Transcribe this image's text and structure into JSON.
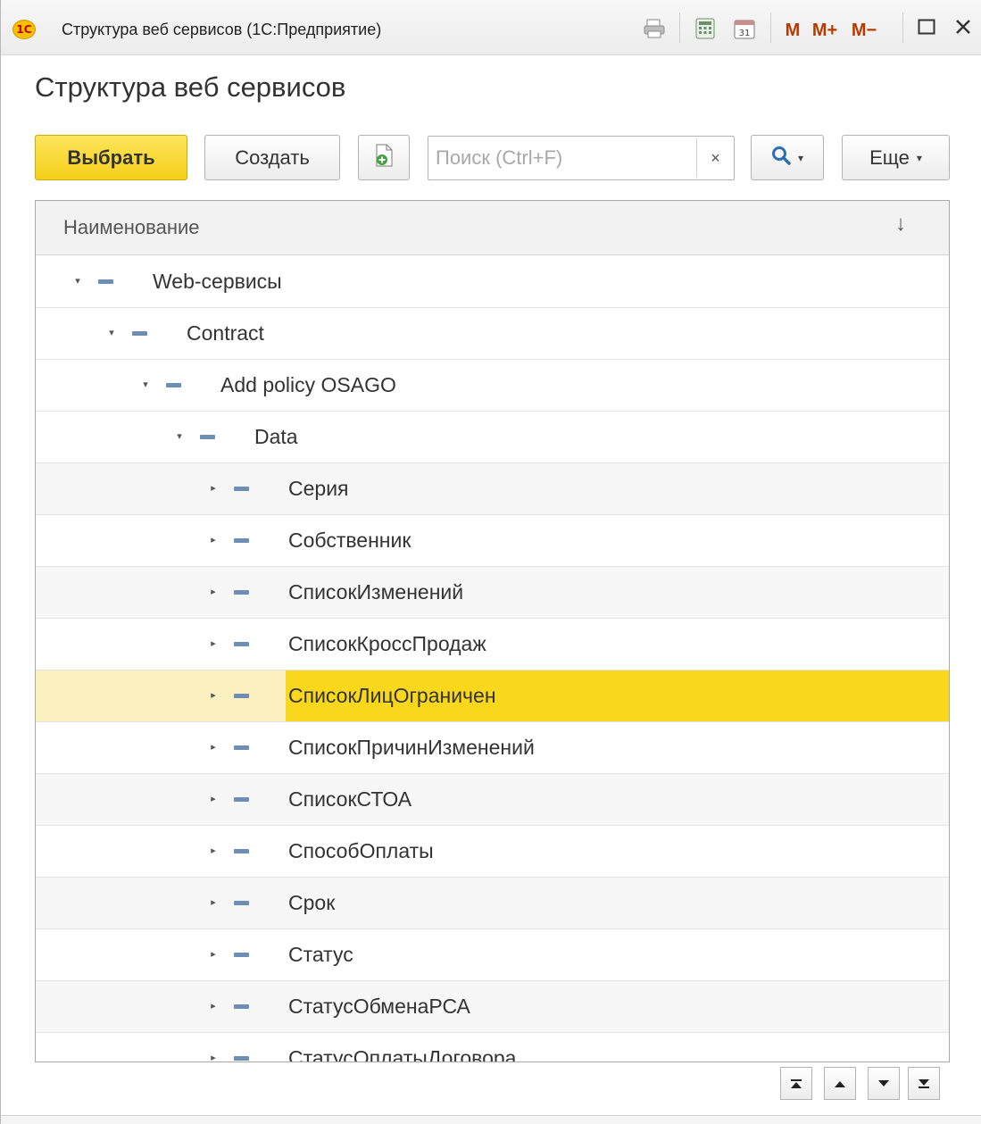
{
  "window": {
    "logo": "1С",
    "title": "Структура веб сервисов  (1С:Предприятие)",
    "memory_buttons": [
      "M",
      "M+",
      "M−"
    ]
  },
  "page": {
    "title": "Структура веб сервисов"
  },
  "toolbar": {
    "select_label": "Выбрать",
    "create_label": "Создать",
    "search_placeholder": "Поиск (Ctrl+F)",
    "search_value": "",
    "clear_label": "×",
    "more_label": "Еще"
  },
  "table": {
    "column_title": "Наименование",
    "sort_indicator": "↓",
    "rows": [
      {
        "label": "Web-сервисы",
        "level": 0,
        "expanded": true,
        "alt": false,
        "selected": false
      },
      {
        "label": "Contract",
        "level": 1,
        "expanded": true,
        "alt": false,
        "selected": false
      },
      {
        "label": "Add policy OSAGO",
        "level": 2,
        "expanded": true,
        "alt": false,
        "selected": false
      },
      {
        "label": "Data",
        "level": 3,
        "expanded": true,
        "alt": false,
        "selected": false
      },
      {
        "label": "Серия",
        "level": 4,
        "expanded": false,
        "alt": true,
        "selected": false
      },
      {
        "label": "Собственник",
        "level": 4,
        "expanded": false,
        "alt": false,
        "selected": false
      },
      {
        "label": "СписокИзменений",
        "level": 4,
        "expanded": false,
        "alt": true,
        "selected": false
      },
      {
        "label": "СписокКроссПродаж",
        "level": 4,
        "expanded": false,
        "alt": false,
        "selected": false
      },
      {
        "label": "СписокЛицОграничен",
        "level": 4,
        "expanded": false,
        "alt": false,
        "selected": true
      },
      {
        "label": "СписокПричинИзменений",
        "level": 4,
        "expanded": false,
        "alt": false,
        "selected": false
      },
      {
        "label": "СписокСТОА",
        "level": 4,
        "expanded": false,
        "alt": true,
        "selected": false
      },
      {
        "label": "СпособОплаты",
        "level": 4,
        "expanded": false,
        "alt": false,
        "selected": false
      },
      {
        "label": "Срок",
        "level": 4,
        "expanded": false,
        "alt": true,
        "selected": false
      },
      {
        "label": "Статус",
        "level": 4,
        "expanded": false,
        "alt": false,
        "selected": false
      },
      {
        "label": "СтатусОбменаРСА",
        "level": 4,
        "expanded": false,
        "alt": true,
        "selected": false
      },
      {
        "label": "СтатусОплатыДоговора",
        "level": 4,
        "expanded": false,
        "alt": false,
        "selected": false
      }
    ]
  },
  "colors": {
    "primary_button": "#f5cf1a",
    "selection": "#f9d71c",
    "selection_row": "#fbf1c0",
    "tree_dash": "#6d8fb6"
  }
}
